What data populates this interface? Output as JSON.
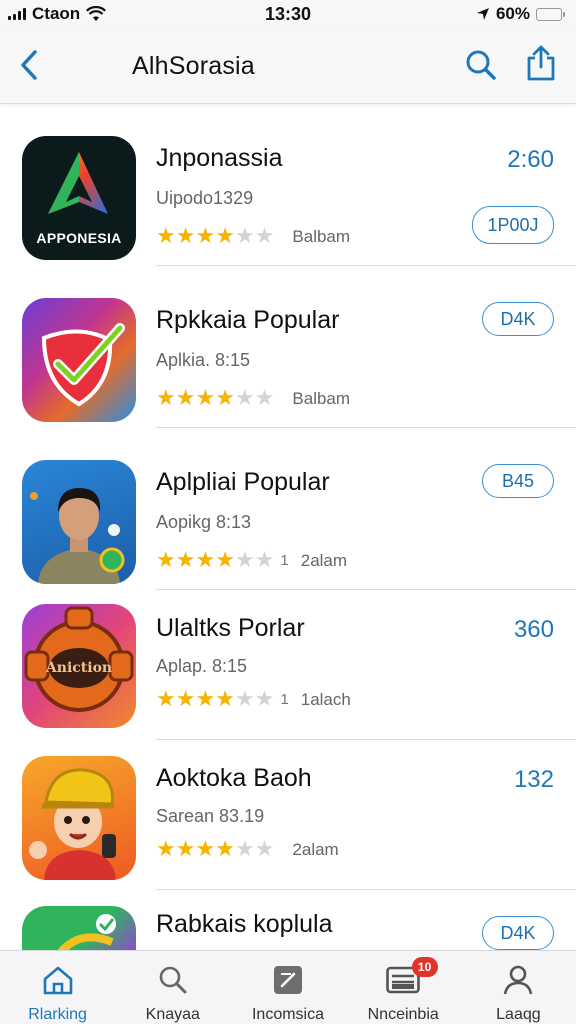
{
  "status_bar": {
    "carrier": "Ctaon",
    "time": "13:30",
    "battery": "60%",
    "battery_level": 0.6
  },
  "nav": {
    "title": "AlhSorasia",
    "back_icon": "chevron-left-icon",
    "search_icon": "search-icon",
    "share_icon": "share-icon"
  },
  "apps": [
    {
      "name": "Jnponassia",
      "subtitle": "Uipodo1329",
      "stars": 4,
      "rating_count": "",
      "rating_label": "Balbam",
      "price": "2:60",
      "price_style": "text",
      "button": "1P00J",
      "icon_text": "APPONESIA",
      "icon": "triangle-logo-icon"
    },
    {
      "name": "Rpkkaia Popular",
      "subtitle": "Aplkia. 8:15",
      "stars": 4,
      "rating_count": "",
      "rating_label": "Balbam",
      "price": "D4K",
      "price_style": "pill",
      "icon": "shield-check-icon"
    },
    {
      "name": "Aplpliai Popular",
      "subtitle": "Aopikg 8:13",
      "stars": 4,
      "rating_count": "1",
      "rating_label": "2alam",
      "price": "B45",
      "price_style": "pill",
      "icon": "person-portrait-icon"
    },
    {
      "name": "Ulaltks Porlar",
      "subtitle": "Aplap. 8:15",
      "stars": 4,
      "rating_count": "1",
      "rating_label": "1alach",
      "price": "360",
      "price_style": "text",
      "icon_text": "Aniction",
      "icon": "game-controller-icon"
    },
    {
      "name": "Aoktoka Baoh",
      "subtitle": "Sarean 83.19",
      "stars": 4,
      "rating_count": "",
      "rating_label": "2alam",
      "price": "132",
      "price_style": "text",
      "icon": "cartoon-character-icon"
    },
    {
      "name": "Rabkais koplula",
      "subtitle": "",
      "stars": 0,
      "rating_count": "",
      "rating_label": "",
      "price": "D4K",
      "price_style": "pill",
      "icon": "colorful-logo-icon"
    }
  ],
  "tabs": [
    {
      "label": "Rlarking",
      "icon": "home-icon",
      "active": true
    },
    {
      "label": "Knayaa",
      "icon": "search-icon",
      "active": false
    },
    {
      "label": "Incomsica",
      "icon": "edit-icon",
      "active": false
    },
    {
      "label": "Nnceinbia",
      "icon": "inbox-icon",
      "active": false,
      "badge": "10"
    },
    {
      "label": "Laaqg",
      "icon": "person-icon",
      "active": false
    }
  ],
  "colors": {
    "accent": "#1e78b8",
    "star": "#f4b400",
    "badge": "#e0342a"
  }
}
